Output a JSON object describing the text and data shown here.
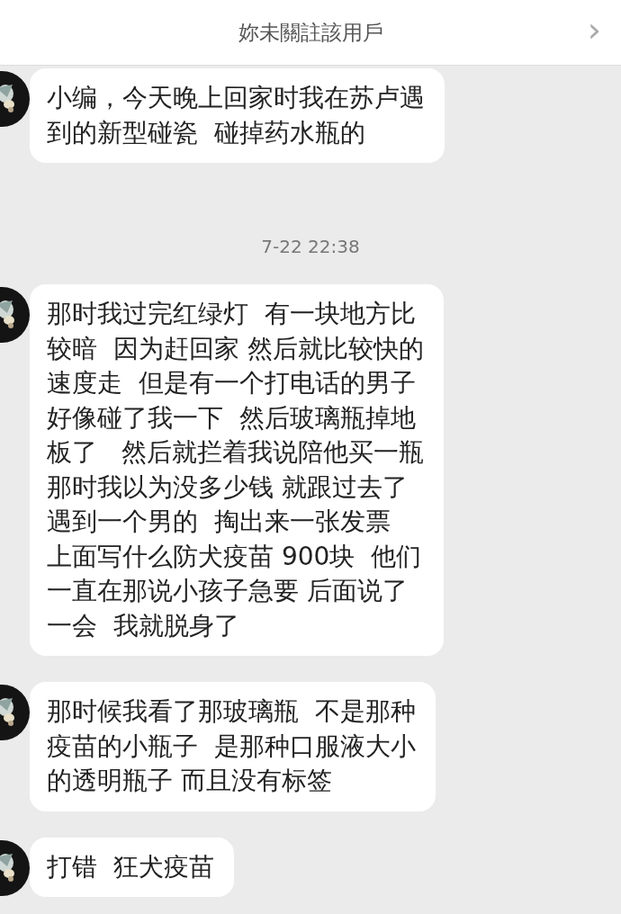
{
  "header": {
    "title": "妳未關註該用戶",
    "chevron": "›"
  },
  "messages": [
    {
      "kind": "bubble",
      "lines": [
        "小编，今天晚上回家时我在苏卢遇",
        "到的新型碰瓷  碰掉药水瓶的"
      ]
    },
    {
      "kind": "time",
      "text": "7-22 22:38"
    },
    {
      "kind": "bubble",
      "lines": [
        "那时我过完红绿灯  有一块地方比",
        "较暗  因为赶回家 然后就比较快的",
        "速度走  但是有一个打电话的男子",
        "好像碰了我一下  然后玻璃瓶掉地",
        "板了   然后就拦着我说陪他买一瓶",
        "那时我以为没多少钱 就跟过去了",
        "遇到一个男的  掏出来一张发票",
        "上面写什么防犬疫苗 900块  他们",
        "一直在那说小孩子急要 后面说了",
        "一会  我就脱身了"
      ]
    },
    {
      "kind": "bubble",
      "lines": [
        "那时候我看了那玻璃瓶  不是那种",
        "疫苗的小瓶子  是那种口服液大小",
        "的透明瓶子 而且没有标签"
      ]
    },
    {
      "kind": "bubble",
      "lines": [
        "打错  狂犬疫苗"
      ]
    }
  ]
}
